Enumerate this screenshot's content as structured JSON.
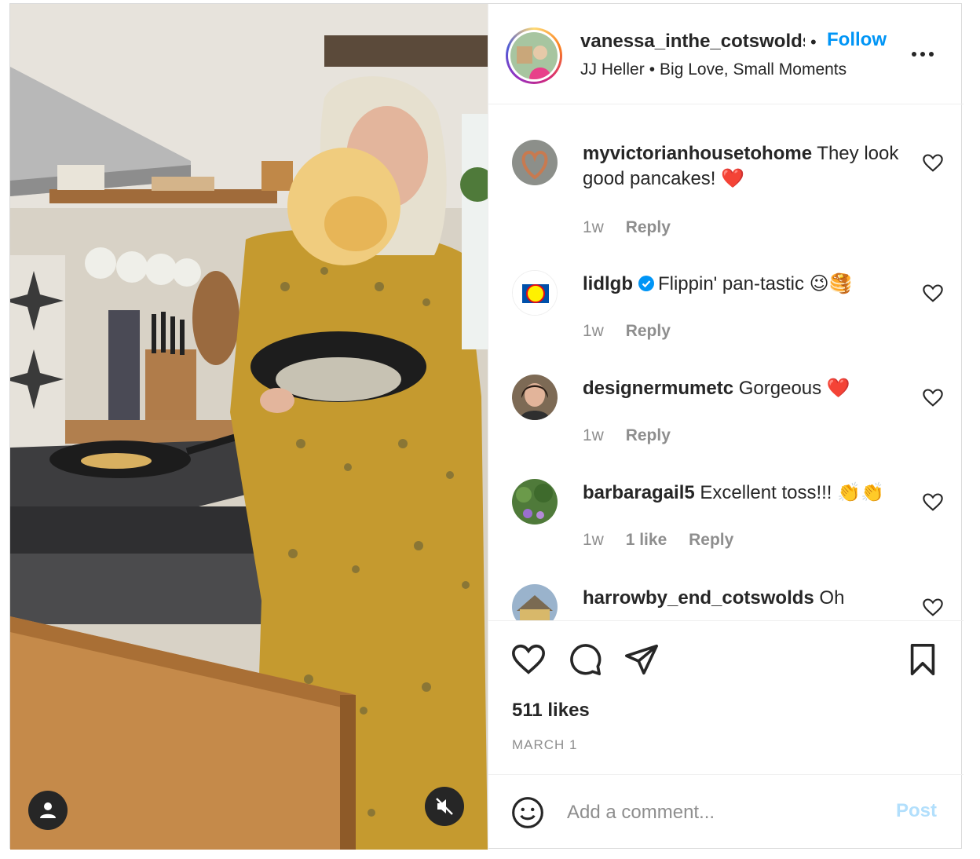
{
  "header": {
    "username": "vanessa_inthe_cotswolds",
    "separator": "•",
    "follow_label": "Follow",
    "audio_artist": "JJ Heller",
    "audio_separator": "•",
    "audio_title": "Big Love, Small Moments",
    "more_icon": "more-options-icon"
  },
  "comments": [
    {
      "username": "myvictorianhousetohome",
      "text": "They look good pancakes! ❤️",
      "verified": false,
      "time": "1w",
      "likes": "",
      "reply_label": "Reply"
    },
    {
      "username": "lidlgb",
      "text": "Flippin' pan-tastic 😉🥞",
      "verified": true,
      "time": "1w",
      "likes": "",
      "reply_label": "Reply"
    },
    {
      "username": "designermumetc",
      "text": "Gorgeous ❤️",
      "verified": false,
      "time": "1w",
      "likes": "",
      "reply_label": "Reply"
    },
    {
      "username": "barbaragail5",
      "text": "Excellent toss!!! 👏👏",
      "verified": false,
      "time": "1w",
      "likes": "1 like",
      "reply_label": "Reply"
    },
    {
      "username": "harrowby_end_cotswolds",
      "text": "Oh",
      "verified": false,
      "time": "",
      "likes": "",
      "reply_label": ""
    }
  ],
  "actions": {
    "likes": "511 likes",
    "date": "MARCH 1"
  },
  "add_comment": {
    "placeholder": "Add a comment...",
    "post_label": "Post"
  },
  "colors": {
    "accent": "#0095f6",
    "post_disabled": "#b2dffc",
    "secondary_text": "#8e8e8e",
    "heart_red": "#ed4956"
  }
}
